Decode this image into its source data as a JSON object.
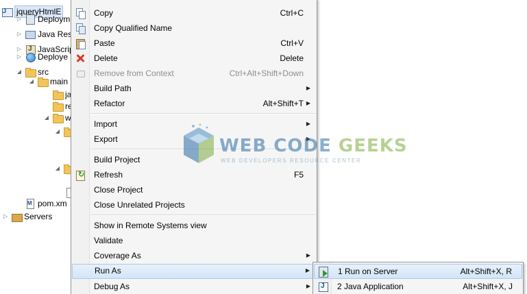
{
  "tree": {
    "rows": [
      {
        "label": "jqueryHtmlE"
      },
      {
        "label": "Deploym"
      },
      {
        "label": "Java Res"
      },
      {
        "label": "JavaScrip"
      },
      {
        "label": "Deploye"
      },
      {
        "label": "src"
      },
      {
        "label": "main"
      },
      {
        "label": "ja"
      },
      {
        "label": "re"
      },
      {
        "label": "w"
      },
      {
        "label": ""
      },
      {
        "label": ""
      },
      {
        "label": ""
      },
      {
        "label": "pom.xm"
      },
      {
        "label": "Servers"
      }
    ]
  },
  "context_menu": {
    "items": [
      {
        "label": "Copy",
        "shortcut": "Ctrl+C",
        "icon": "copy-icon"
      },
      {
        "label": "Copy Qualified Name",
        "shortcut": "",
        "icon": "copy-qualified-name-icon"
      },
      {
        "label": "Paste",
        "shortcut": "Ctrl+V",
        "icon": "paste-icon"
      },
      {
        "label": "Delete",
        "shortcut": "Delete",
        "icon": "delete-icon"
      },
      {
        "label": "Remove from Context",
        "shortcut": "Ctrl+Alt+Shift+Down",
        "icon": "remove-context-icon",
        "disabled": true
      },
      {
        "label": "Build Path",
        "shortcut": "",
        "submenu": true
      },
      {
        "label": "Refactor",
        "shortcut": "Alt+Shift+T",
        "submenu": true
      },
      {
        "label": "Import",
        "shortcut": "",
        "submenu": true
      },
      {
        "label": "Export",
        "shortcut": "",
        "submenu": true
      },
      {
        "label": "Build Project",
        "shortcut": ""
      },
      {
        "label": "Refresh",
        "shortcut": "F5",
        "icon": "refresh-icon"
      },
      {
        "label": "Close Project",
        "shortcut": ""
      },
      {
        "label": "Close Unrelated Projects",
        "shortcut": ""
      },
      {
        "label": "Show in Remote Systems view",
        "shortcut": ""
      },
      {
        "label": "Validate",
        "shortcut": ""
      },
      {
        "label": "Coverage As",
        "shortcut": "",
        "submenu": true
      },
      {
        "label": "Run As",
        "shortcut": "",
        "submenu": true,
        "highlighted": true
      },
      {
        "label": "Debug As",
        "shortcut": "",
        "submenu": true
      }
    ],
    "arrow_glyph": "▶"
  },
  "run_as_submenu": {
    "items": [
      {
        "label": "1 Run on Server",
        "shortcut": "Alt+Shift+X, R",
        "icon": "run-on-server-icon",
        "highlighted": true
      },
      {
        "label": "2 Java Application",
        "shortcut": "Alt+Shift+X, J",
        "icon": "java-application-icon"
      }
    ]
  },
  "watermark": {
    "title_part1": "WEB CODE",
    "title_part2": "GEEKS",
    "subtitle": "WEB DEVELOPERS RESOURCE CENTER"
  },
  "colors": {
    "highlight_bg": "#d9e8f8",
    "highlight_border": "#a8c8ec",
    "menu_bg": "#f5f5f5",
    "disabled_text": "#8d8d8d",
    "accent_blue": "#2a6ea6",
    "accent_green": "#7cae3c"
  }
}
